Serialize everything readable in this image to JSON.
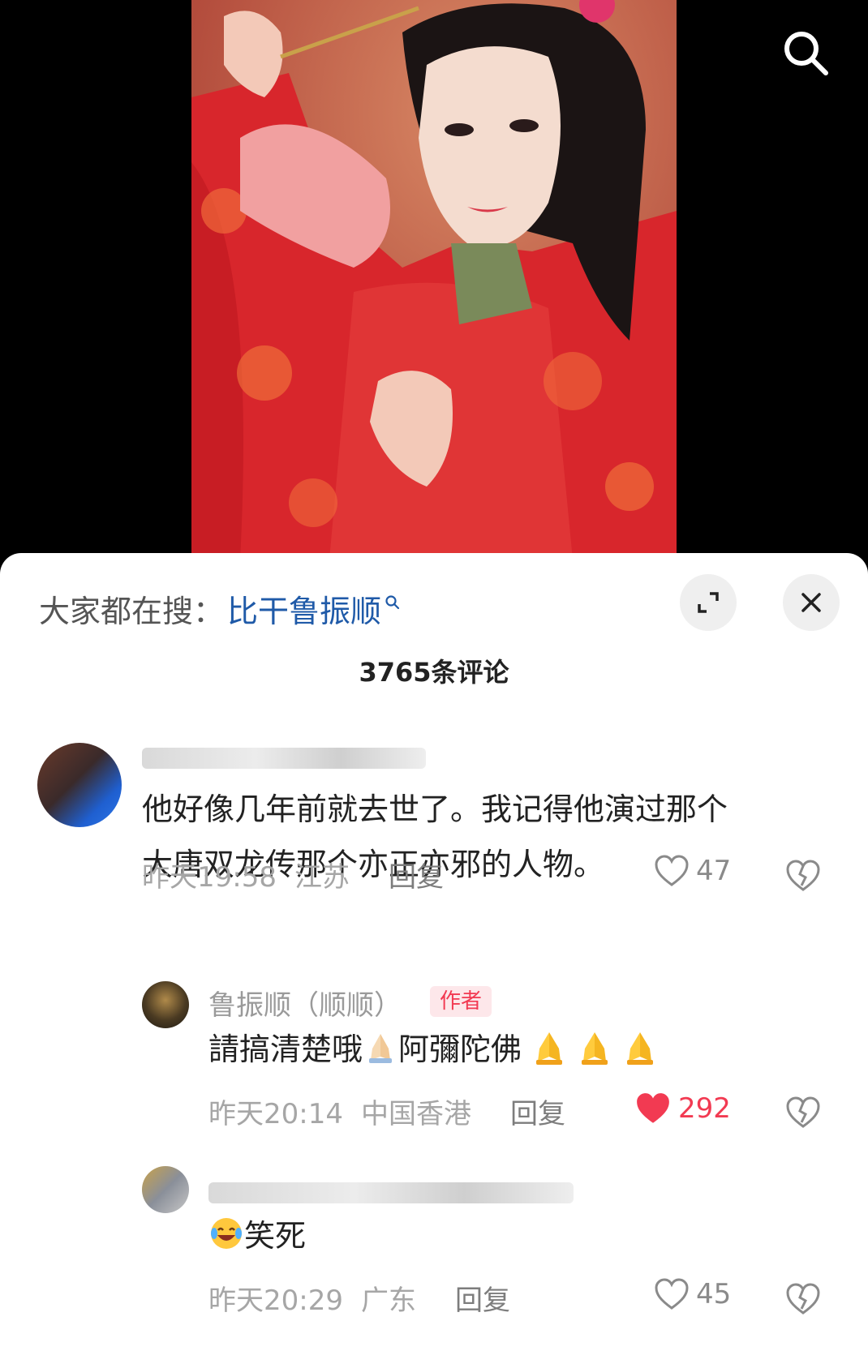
{
  "search": {
    "icon": "search-icon"
  },
  "sheet": {
    "trending_prefix": "大家都在搜：",
    "trending_term": "比干鲁振顺",
    "comment_count": "3765条评论"
  },
  "comments": [
    {
      "username": "",
      "text_line1": "他好像几年前就去世了。我记得他演过那个",
      "text_line2": "大唐双龙传那个亦正亦邪的人物。",
      "time": "昨天19:58",
      "location": "江苏",
      "reply_label": "回复",
      "likes": "47",
      "liked": false
    },
    {
      "username": "鲁振顺（顺顺）",
      "badge": "作者",
      "text_before": "請搞清楚哦",
      "text_after": "阿彌陀佛",
      "emoji": "folded-hands",
      "time": "昨天20:14",
      "location": "中国香港",
      "reply_label": "回复",
      "likes": "292",
      "liked": true,
      "like_color": "#f23a52"
    },
    {
      "username": "",
      "text": "笑死",
      "emoji": "laughing-crying",
      "time": "昨天20:29",
      "location": "广东",
      "reply_label": "回复",
      "likes": "45",
      "liked": false
    }
  ]
}
